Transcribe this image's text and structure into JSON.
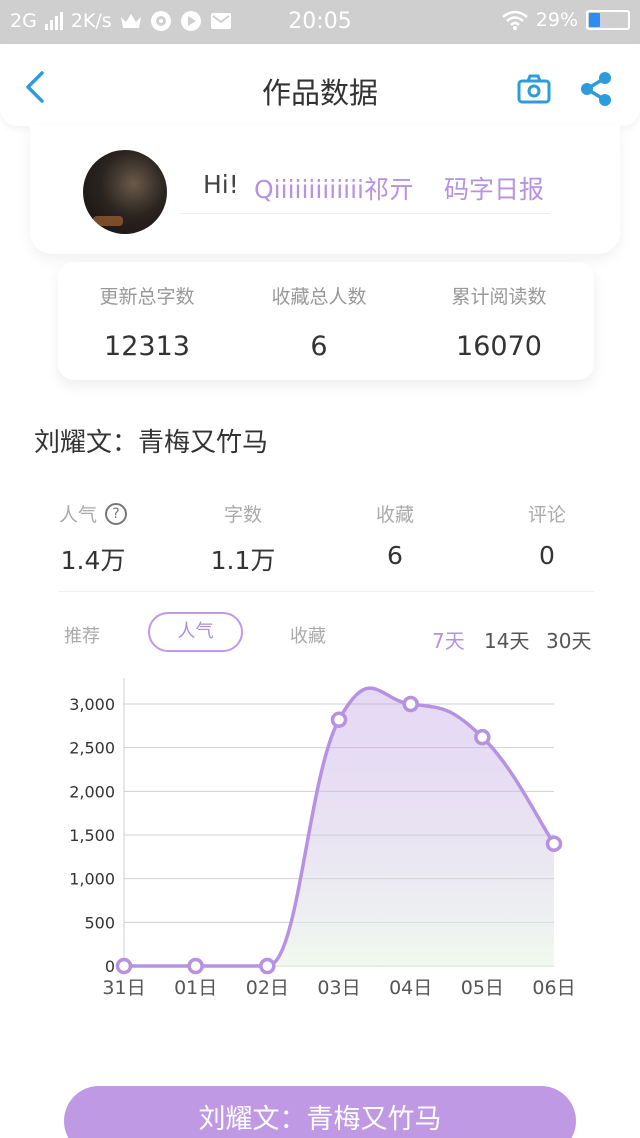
{
  "status_bar": {
    "network": "2G",
    "speed": "2K/s",
    "time": "20:05",
    "battery_text": "29%",
    "battery_level": 0.29
  },
  "header": {
    "title": "作品数据",
    "back_icon": "chevron-left-icon",
    "camera_icon": "camera-icon",
    "share_icon": "share-icon",
    "accent_color": "#2d9cdb"
  },
  "profile": {
    "greeting": "Hi!",
    "username": "Qiiiiiiiiiiiii祁亓",
    "daily_report": "码字日报",
    "accent_color": "#b792e2"
  },
  "summary": [
    {
      "label": "更新总字数",
      "value": "12313"
    },
    {
      "label": "收藏总人数",
      "value": "6"
    },
    {
      "label": "累计阅读数",
      "value": "16070"
    }
  ],
  "work_title": "刘耀文：青梅又竹马",
  "metrics": [
    {
      "label": "人气",
      "value": "1.4万"
    },
    {
      "label": "字数",
      "value": "1.1万"
    },
    {
      "label": "收藏",
      "value": "6"
    },
    {
      "label": "评论",
      "value": "0"
    }
  ],
  "tabs": [
    "推荐",
    "人气",
    "收藏"
  ],
  "active_tab": "人气",
  "ranges": [
    "7天",
    "14天",
    "30天"
  ],
  "active_range": "7天",
  "chart_data": {
    "type": "area",
    "x": [
      "31日",
      "01日",
      "02日",
      "03日",
      "04日",
      "05日",
      "06日"
    ],
    "series": [
      {
        "values": [
          0,
          0,
          0,
          2820,
          3000,
          2620,
          1400
        ]
      }
    ],
    "ylim": [
      0,
      3000
    ],
    "yticks": [
      "0",
      "500",
      "1,000",
      "1,500",
      "2,000",
      "2,500",
      "3,000"
    ],
    "grid": true,
    "color": "#b792e2"
  },
  "bottom_button": "刘耀文：青梅又竹马"
}
